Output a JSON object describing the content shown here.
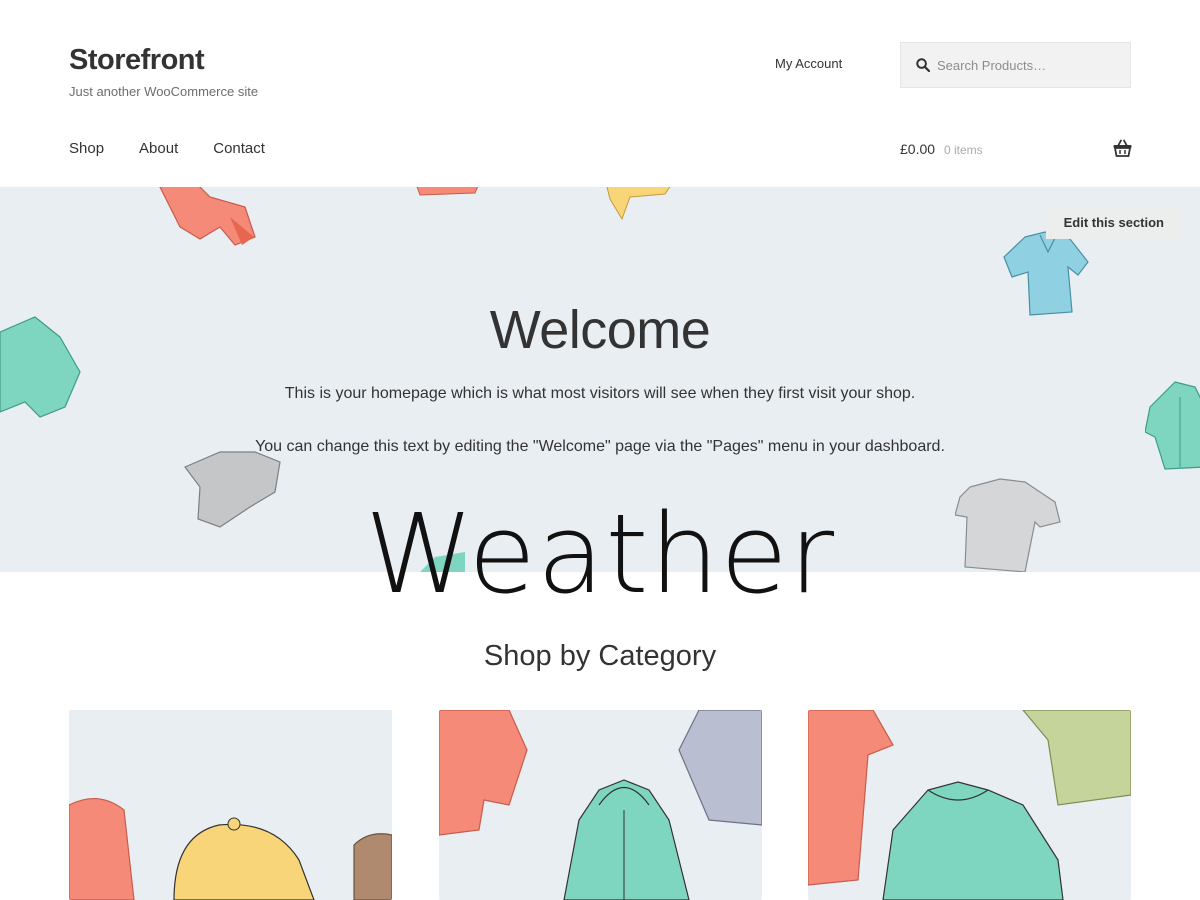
{
  "header": {
    "site_title": "Storefront",
    "tagline": "Just another WooCommerce site",
    "my_account": "My Account",
    "search_placeholder": "Search Products…"
  },
  "nav": {
    "items": [
      "Shop",
      "About",
      "Contact"
    ]
  },
  "cart": {
    "total": "£0.00",
    "count": "0 items"
  },
  "hero": {
    "edit_label": "Edit this section",
    "title": "Welcome",
    "text1": "This is your homepage which is what most visitors will see when they first visit your shop.",
    "text2": "You can change this text by editing the \"Welcome\" page via the \"Pages\" menu in your dashboard."
  },
  "overlay": {
    "word": "Weather"
  },
  "category_section": {
    "title": "Shop by Category"
  },
  "icons": {
    "search": "search-icon",
    "basket": "basket-icon"
  },
  "colors": {
    "hero_bg": "#e9eef2",
    "search_bg": "#f2f2f2",
    "coral": "#f58a78",
    "mint": "#7fd6c0",
    "yellow": "#f9d57a",
    "sky": "#8fd0e2",
    "grey": "#c4c6c8",
    "lavender": "#b9bfd0",
    "olive": "#c5d49a"
  }
}
